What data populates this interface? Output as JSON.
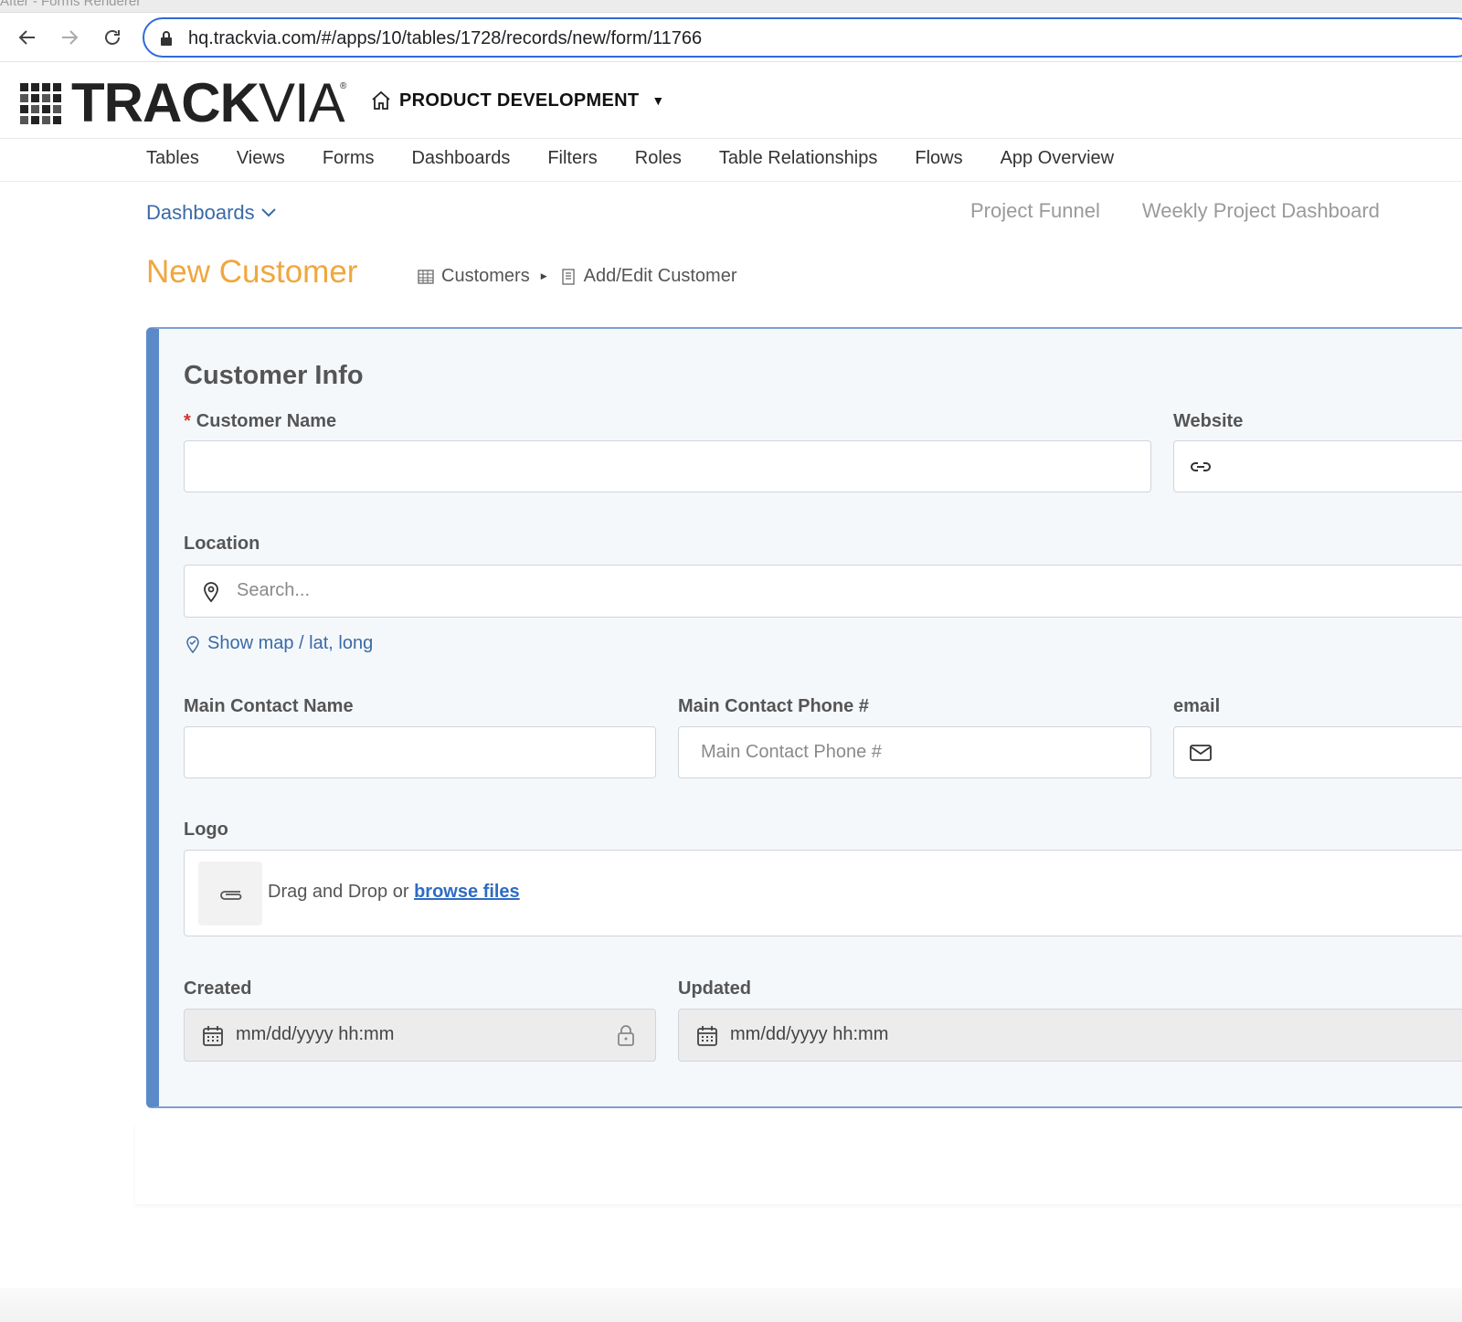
{
  "browser": {
    "tab_title": "After - Forms Renderer",
    "url": "hq.trackvia.com/#/apps/10/tables/1728/records/new/form/11766"
  },
  "header": {
    "logo_bold": "TRACK",
    "logo_light": "VIA",
    "logo_registered": "®",
    "app_name": "PRODUCT DEVELOPMENT",
    "app_caret": "▼"
  },
  "nav": {
    "items": [
      "Tables",
      "Views",
      "Forms",
      "Dashboards",
      "Filters",
      "Roles",
      "Table Relationships",
      "Flows",
      "App Overview"
    ]
  },
  "dashboards": {
    "dropdown_label": "Dashboards",
    "links": [
      "Project Funnel",
      "Weekly Project Dashboard"
    ]
  },
  "page": {
    "title": "New Customer",
    "breadcrumb": [
      "Customers",
      "Add/Edit Customer"
    ]
  },
  "form": {
    "section_title": "Customer Info",
    "required_marker": "*",
    "fields": {
      "customer_name": {
        "label": "Customer Name",
        "value": ""
      },
      "website": {
        "label": "Website",
        "value": ""
      },
      "location": {
        "label": "Location",
        "placeholder": "Search..."
      },
      "show_map": "Show map / lat, long",
      "main_contact_name": {
        "label": "Main Contact Name",
        "value": ""
      },
      "main_contact_phone": {
        "label": "Main Contact Phone #",
        "placeholder": "Main Contact Phone #"
      },
      "email": {
        "label": "email",
        "value": ""
      },
      "logo": {
        "label": "Logo",
        "drop_text": "Drag and Drop or ",
        "browse_label": "browse files"
      },
      "created": {
        "label": "Created",
        "value": "mm/dd/yyyy hh:mm"
      },
      "updated": {
        "label": "Updated",
        "value": "mm/dd/yyyy hh:mm"
      }
    }
  },
  "colors": {
    "accent_blue": "#5b8ac9",
    "link_blue": "#3a6aa6",
    "title_orange": "#f0a73c",
    "required_red": "#d0332f"
  },
  "icons": {
    "back": "arrow-left-icon",
    "forward": "arrow-right-icon",
    "reload": "reload-icon",
    "lock": "lock-icon",
    "home": "home-icon",
    "table": "table-icon",
    "form": "form-icon",
    "link": "link-icon",
    "location": "map-pin-icon",
    "map": "map-check-icon",
    "mail": "mail-icon",
    "clip": "paperclip-icon",
    "calendar": "calendar-icon",
    "padlock": "padlock-icon"
  }
}
